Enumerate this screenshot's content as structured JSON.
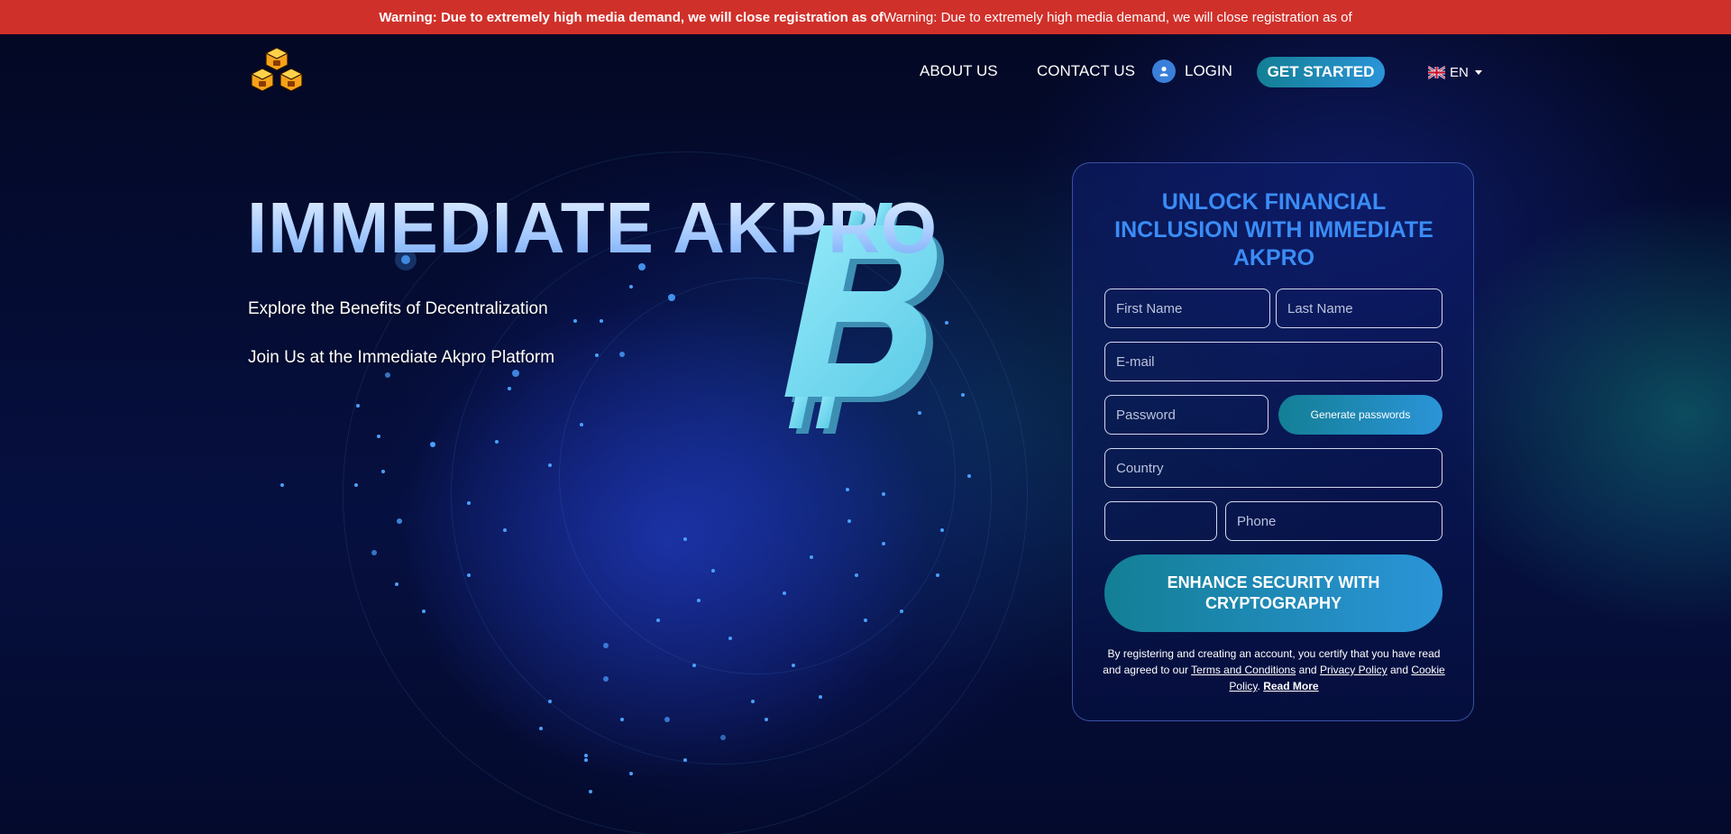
{
  "warning": {
    "bold": "Warning: Due to extremely high media demand, we will close registration as of",
    "normal": "Warning: Due to extremely high media demand, we will close registration as of"
  },
  "nav": {
    "about": "ABOUT US",
    "contact": "CONTACT US",
    "login": "LOGIN",
    "get_started": "GET STARTED",
    "language": "EN"
  },
  "hero": {
    "title": "IMMEDIATE AKPRO",
    "tagline_1": "Explore the Benefits of Decentralization",
    "tagline_2": "Join Us at the Immediate Akpro Platform"
  },
  "form": {
    "title": "UNLOCK FINANCIAL INCLUSION WITH IMMEDIATE AKPRO",
    "first_name_placeholder": "First Name",
    "last_name_placeholder": "Last Name",
    "email_placeholder": "E-mail",
    "password_placeholder": "Password",
    "generate_label": "Generate passwords",
    "country_placeholder": "Country",
    "phone_code_value": "",
    "phone_placeholder": "Phone",
    "submit_label": "ENHANCE SECURITY WITH CRYPTOGRAPHY",
    "legal_prefix": "By registering and creating an account, you certify that you have read and agreed to our",
    "terms_link": "Terms and Conditions",
    "and_1": "and",
    "privacy_link": "Privacy Policy",
    "and_2": "and",
    "cookie_link": "Cookie Policy",
    "period": ".",
    "read_more": "Read More"
  },
  "colors": {
    "warning_bg": "#d0302a",
    "accent_blue": "#3a8cf5",
    "button_gradient_start": "#137f95",
    "button_gradient_end": "#2b94d8",
    "bitcoin": "#6fd8f0"
  },
  "icons": {
    "logo": "cube-cluster-logo",
    "login": "user-icon",
    "language": "uk-flag-icon",
    "dropdown": "caret-down-icon",
    "bitcoin": "bitcoin-symbol"
  }
}
